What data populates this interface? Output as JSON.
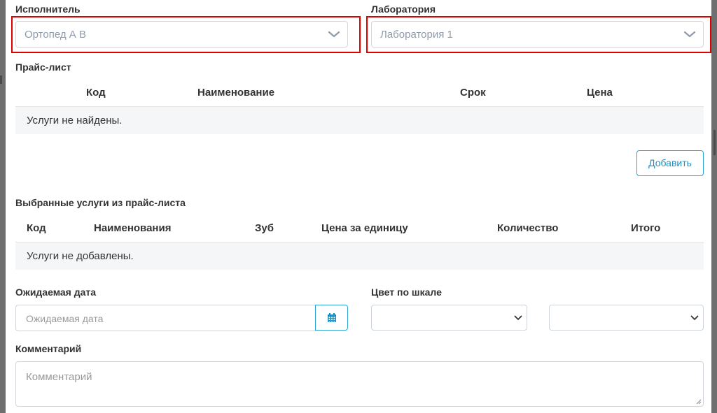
{
  "performer": {
    "label": "Исполнитель",
    "value": "Ортопед А В"
  },
  "laboratory": {
    "label": "Лаборатория",
    "value": "Лаборатория 1"
  },
  "price_list": {
    "title": "Прайс-лист",
    "columns": [
      "Код",
      "Наименование",
      "Срок",
      "Цена"
    ],
    "empty_text": "Услуги не найдены.",
    "add_button": "Добавить"
  },
  "selected_services": {
    "title": "Выбранные услуги из прайс-листа",
    "columns": [
      "Код",
      "Наименования",
      "Зуб",
      "Цена за единицу",
      "Количество",
      "Итого"
    ],
    "empty_text": "Услуги не добавлены."
  },
  "expected_date": {
    "label": "Ожидаемая дата",
    "placeholder": "Ожидаемая дата"
  },
  "color_scale": {
    "label": "Цвет по шкале",
    "value_1": "",
    "value_2": ""
  },
  "comment": {
    "label": "Комментарий",
    "placeholder": "Комментарий"
  },
  "colors": {
    "highlight": "#e00000",
    "accent": "#2aa4d5",
    "row_bg": "#f5f6f7"
  }
}
